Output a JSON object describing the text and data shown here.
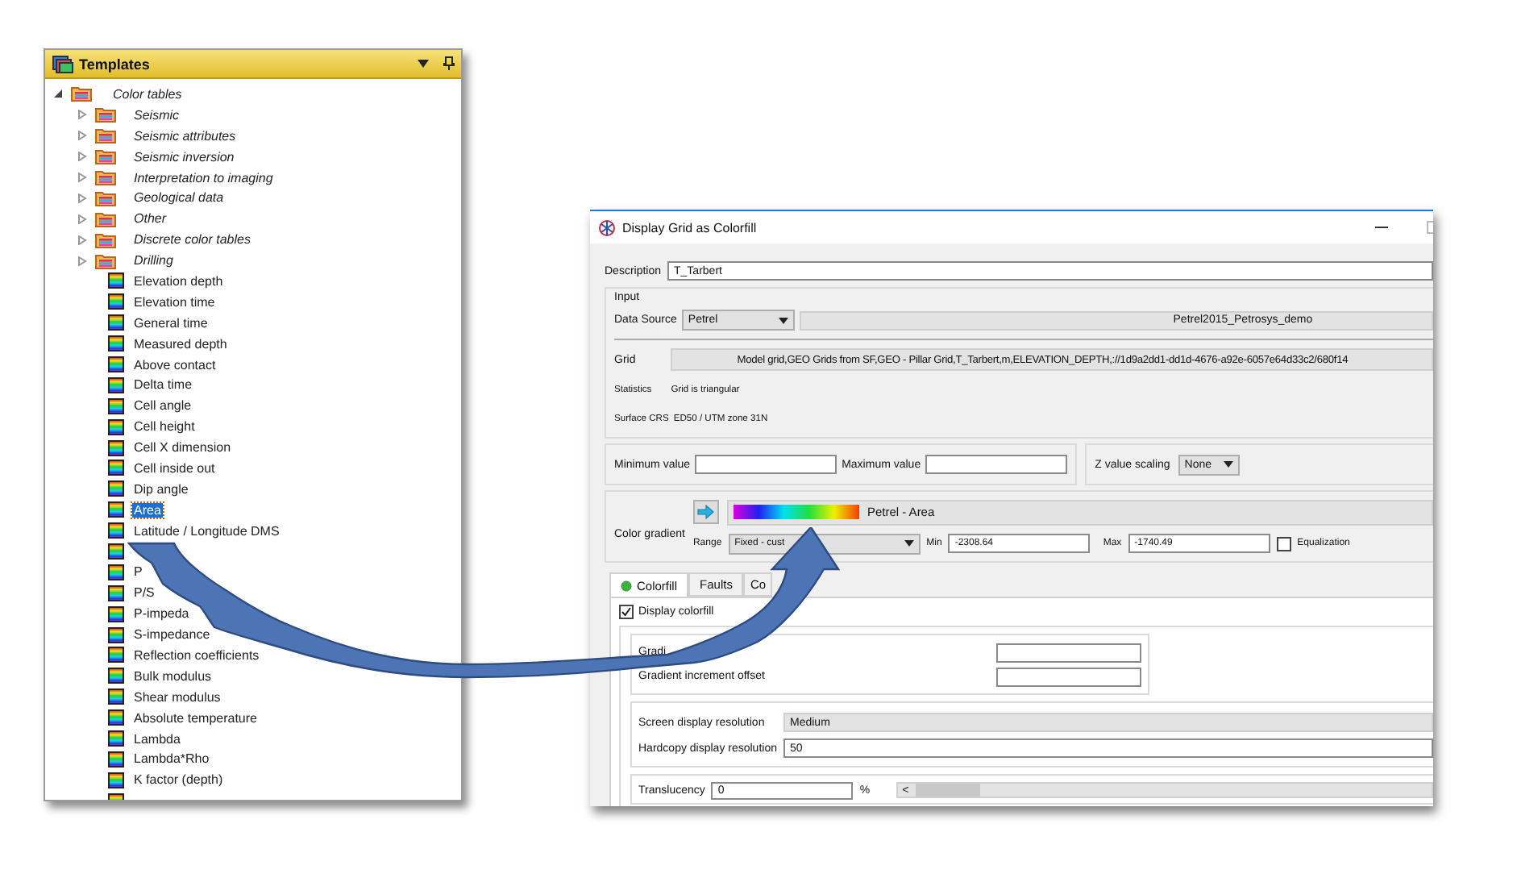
{
  "templates_panel": {
    "title": "Templates",
    "tree": [
      {
        "label": "Color tables",
        "kind": "folder",
        "expanded": true,
        "children": [
          {
            "label": "Seismic",
            "kind": "folder",
            "expanded": false
          },
          {
            "label": "Seismic attributes",
            "kind": "folder",
            "expanded": false
          },
          {
            "label": "Seismic inversion",
            "kind": "folder",
            "expanded": false
          },
          {
            "label": "Interpretation to imaging",
            "kind": "folder",
            "expanded": false
          },
          {
            "label": "Geological data",
            "kind": "folder",
            "expanded": false
          },
          {
            "label": "Other",
            "kind": "folder",
            "expanded": false
          },
          {
            "label": "Discrete color tables",
            "kind": "folder",
            "expanded": false
          },
          {
            "label": "Drilling",
            "kind": "folder",
            "expanded": false
          },
          {
            "label": "Elevation depth",
            "kind": "item",
            "selected": false
          },
          {
            "label": "Elevation time",
            "kind": "item",
            "selected": false
          },
          {
            "label": "General time",
            "kind": "item",
            "selected": false
          },
          {
            "label": "Measured depth",
            "kind": "item",
            "selected": false
          },
          {
            "label": "Above contact",
            "kind": "item",
            "selected": false
          },
          {
            "label": "Delta time",
            "kind": "item",
            "selected": false
          },
          {
            "label": "Cell angle",
            "kind": "item",
            "selected": false
          },
          {
            "label": "Cell height",
            "kind": "item",
            "selected": false
          },
          {
            "label": "Cell X dimension",
            "kind": "item",
            "selected": false
          },
          {
            "label": "Cell inside out",
            "kind": "item",
            "selected": false
          },
          {
            "label": "Dip angle",
            "kind": "item",
            "selected": false
          },
          {
            "label": "Area",
            "kind": "item",
            "selected": true
          },
          {
            "label": "Latitude / Longitude DMS",
            "kind": "item",
            "selected": false
          },
          {
            "kind": "item",
            "selected": false
          },
          {
            "label": "P",
            "kind": "item",
            "selected": false
          },
          {
            "label": "P/S",
            "kind": "item",
            "selected": false
          },
          {
            "label": "P-impeda",
            "kind": "item",
            "selected": false
          },
          {
            "label": "S-impedance",
            "kind": "item",
            "selected": false
          },
          {
            "label": "Reflection coefficients",
            "kind": "item",
            "selected": false
          },
          {
            "label": "Bulk modulus",
            "kind": "item",
            "selected": false
          },
          {
            "label": "Shear modulus",
            "kind": "item",
            "selected": false
          },
          {
            "label": "Absolute temperature",
            "kind": "item",
            "selected": false
          },
          {
            "label": "Lambda",
            "kind": "item",
            "selected": false
          },
          {
            "label": "Lambda*Rho",
            "kind": "item",
            "selected": false
          },
          {
            "label": "K factor (depth)",
            "kind": "item",
            "selected": false
          },
          {
            "kind": "item",
            "selected": false
          }
        ]
      }
    ]
  },
  "dialog": {
    "title": "Display Grid as Colorfill",
    "description_label": "Description",
    "description": "T_Tarbert",
    "input_group": {
      "title": "Input",
      "data_source_label": "Data Source",
      "data_source": "Petrel",
      "project": "Petrel2015_Petrosys_demo",
      "grid_label": "Grid",
      "grid": "Model grid,GEO Grids from SF,GEO - Pillar Grid,T_Tarbert,m,ELEVATION_DEPTH,://1d9a2dd1-dd1d-4676-a92e-6057e64d33c2/680f14",
      "statistics_label": "Statistics",
      "statistics": "Grid is triangular",
      "crs_label": "Surface CRS",
      "crs": "ED50 / UTM zone 31N"
    },
    "min_label": "Minimum value",
    "max_label": "Maximum value",
    "z_scaling_label": "Z value scaling",
    "z_scaling": "None",
    "color_gradient": {
      "label": "Color gradient",
      "name": "Petrel - Area",
      "range_label": "Range",
      "range": "Fixed - cust",
      "min_label": "Min",
      "min": "-2308.64",
      "max_label": "Max",
      "max": "-1740.49",
      "equalization_label": "Equalization",
      "equalization": false
    },
    "tabs": [
      {
        "label": "Colorfill",
        "selected": true
      },
      {
        "label": "Faults",
        "selected": false
      },
      {
        "label": "Co",
        "selected": false
      }
    ],
    "display_colorfill": {
      "label": "Display colorfill",
      "checked": true
    },
    "gradient_increment_label": "Gradi",
    "gradient_offset_label": "Gradient increment offset",
    "screen_res_label": "Screen display resolution",
    "screen_res": "Medium",
    "hardcopy_label": "Hardcopy display resolution",
    "hardcopy": "50",
    "translucency_label": "Translucency",
    "translucency": "0",
    "percent": "%",
    "translucency_slider": {
      "scroll_left": "<",
      "level": 0
    }
  }
}
